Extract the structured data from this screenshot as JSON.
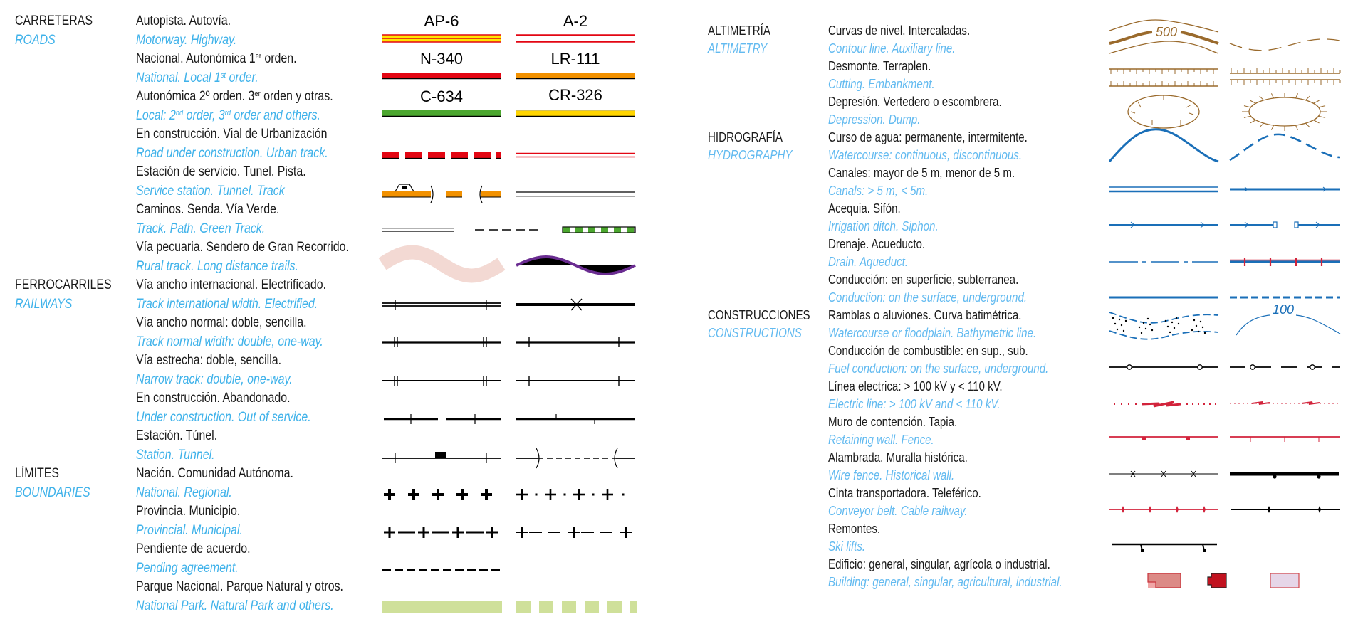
{
  "colors": {
    "text": "#1b1b1b",
    "english_text": "#3fb2ea",
    "road_red": "#e30613",
    "road_yellow": "#ffe600",
    "road_orange": "#f29100",
    "road_green": "#4ca72f",
    "water_blue": "#1a6fb8",
    "contour_brown": "#9a6a2c",
    "park_green": "#cfe09a",
    "trail_purple": "#6a2c91",
    "rural_pink": "#f3d9d3"
  },
  "left": {
    "categories": [
      {
        "row": 0,
        "es": "CARRETERAS",
        "en": "ROADS"
      },
      {
        "row": 7,
        "es": "FERROCARRILES",
        "en": "RAILWAYS"
      },
      {
        "row": 12,
        "es": "LÍMITES",
        "en": "BOUNDARIES"
      }
    ],
    "items": [
      {
        "es": [
          {
            "t": "Autopista. Autovía."
          }
        ],
        "en": [
          {
            "t": "Motorway. Highway."
          }
        ],
        "symbol": "motorway-highway",
        "labels": [
          "AP-6",
          "A-2"
        ]
      },
      {
        "es": [
          {
            "t": "Nacional. Autonómica 1"
          },
          {
            "sup": "er"
          },
          {
            "t": " orden."
          }
        ],
        "en": [
          {
            "t": "National. Local 1"
          },
          {
            "sup": "st"
          },
          {
            "t": " order."
          }
        ],
        "symbol": "national-local",
        "labels": [
          "N-340",
          "LR-111"
        ]
      },
      {
        "es": [
          {
            "t": "Autonómica 2º orden. 3"
          },
          {
            "sup": "er"
          },
          {
            "t": " orden y otras."
          }
        ],
        "en": [
          {
            "t": "Local: 2"
          },
          {
            "sup": "nd"
          },
          {
            "t": " order, 3"
          },
          {
            "sup": "rd"
          },
          {
            "t": " order and others."
          }
        ],
        "symbol": "local-others",
        "labels": [
          "C-634",
          "CR-326"
        ]
      },
      {
        "es": [
          {
            "t": "En construcción. Vial de Urbanización"
          }
        ],
        "en": [
          {
            "t": "Road under construction. Urban track."
          }
        ],
        "symbol": "road-construction-urban"
      },
      {
        "es": [
          {
            "t": "Estación de servicio. Tunel. Pista."
          }
        ],
        "en": [
          {
            "t": "Service station. Tunnel. Track"
          }
        ],
        "symbol": "service-station-tunnel-track"
      },
      {
        "es": [
          {
            "t": "Caminos. Senda. Vía Verde."
          }
        ],
        "en": [
          {
            "t": "Track. Path. Green Track."
          }
        ],
        "symbol": "track-path-green"
      },
      {
        "es": [
          {
            "t": "Vía pecuaria. Sendero de Gran Recorrido."
          }
        ],
        "en": [
          {
            "t": "Rural track. Long distance trails."
          }
        ],
        "symbol": "rural-trail"
      },
      {
        "es": [
          {
            "t": "Vía ancho internacional. Electrificado."
          }
        ],
        "en": [
          {
            "t": "Track international width. Electrified."
          }
        ],
        "symbol": "rail-international"
      },
      {
        "es": [
          {
            "t": "Vía ancho normal: doble, sencilla."
          }
        ],
        "en": [
          {
            "t": "Track normal width: double, one-way."
          }
        ],
        "symbol": "rail-normal"
      },
      {
        "es": [
          {
            "t": "Vía estrecha: doble, sencilla."
          }
        ],
        "en": [
          {
            "t": "Narrow track: double, one-way."
          }
        ],
        "symbol": "rail-narrow"
      },
      {
        "es": [
          {
            "t": "En construcción. Abandonado."
          }
        ],
        "en": [
          {
            "t": "Under construction. Out of service."
          }
        ],
        "symbol": "rail-construction"
      },
      {
        "es": [
          {
            "t": "Estación. Túnel."
          }
        ],
        "en": [
          {
            "t": "Station. Tunnel."
          }
        ],
        "symbol": "rail-station-tunnel"
      },
      {
        "es": [
          {
            "t": "Nación. Comunidad Autónoma."
          }
        ],
        "en": [
          {
            "t": "National. Regional."
          }
        ],
        "symbol": "boundary-national-regional"
      },
      {
        "es": [
          {
            "t": "Provincia. Municipio."
          }
        ],
        "en": [
          {
            "t": "Provincial. Municipal."
          }
        ],
        "symbol": "boundary-provincial-municipal"
      },
      {
        "es": [
          {
            "t": "Pendiente de acuerdo."
          }
        ],
        "en": [
          {
            "t": "Pending agreement."
          }
        ],
        "symbol": "boundary-pending"
      },
      {
        "es": [
          {
            "t": "Parque Nacional. Parque Natural y otros."
          }
        ],
        "en": [
          {
            "t": "National Park. Natural Park and others."
          }
        ],
        "symbol": "park"
      }
    ]
  },
  "right": {
    "categories": [
      {
        "row": 0,
        "es": "ALTIMETRÍA",
        "en": "ALTIMETRY"
      },
      {
        "row": 3,
        "es": "HIDROGRAFÍA",
        "en": "HYDROGRAPHY"
      },
      {
        "row": 8,
        "es": "CONSTRUCCIONES",
        "en": "CONSTRUCTIONS"
      }
    ],
    "items": [
      {
        "es": [
          {
            "t": "Curvas de nivel. Intercaladas."
          }
        ],
        "en": [
          {
            "t": "Contour line. Auxiliary line."
          }
        ],
        "symbol": "contour",
        "labels": [
          "500"
        ]
      },
      {
        "es": [
          {
            "t": "Desmonte. Terraplen."
          }
        ],
        "en": [
          {
            "t": "Cutting. Embankment."
          }
        ],
        "symbol": "cutting-embankment"
      },
      {
        "es": [
          {
            "t": "Depresión. Vertedero o escombrera."
          }
        ],
        "en": [
          {
            "t": "Depression. Dump."
          }
        ],
        "symbol": "depression-dump"
      },
      {
        "es": [
          {
            "t": "Curso de agua: permanente, intermitente."
          }
        ],
        "en": [
          {
            "t": "Watercourse: continuous, discontinuous."
          }
        ],
        "symbol": "watercourse"
      },
      {
        "es": [
          {
            "t": "Canales: mayor de 5 m, menor de 5 m."
          }
        ],
        "en": [
          {
            "t": "Canals: > 5 m, < 5m."
          }
        ],
        "symbol": "canals"
      },
      {
        "es": [
          {
            "t": "Acequia. Sifón."
          }
        ],
        "en": [
          {
            "t": "Irrigation ditch. Siphon."
          }
        ],
        "symbol": "irrigation-siphon"
      },
      {
        "es": [
          {
            "t": "Drenaje. Acueducto."
          }
        ],
        "en": [
          {
            "t": "Drain. Aqueduct."
          }
        ],
        "symbol": "drain-aqueduct"
      },
      {
        "es": [
          {
            "t": "Conducción: en superficie, subterranea."
          }
        ],
        "en": [
          {
            "t": "Conduction: on the surface, underground."
          }
        ],
        "symbol": "conduction"
      },
      {
        "es": [
          {
            "t": "Ramblas o aluviones. Curva batimétrica."
          }
        ],
        "en": [
          {
            "t": "Watercourse or floodplain. Bathymetric line."
          }
        ],
        "symbol": "floodplain-bathymetric",
        "labels": [
          "100"
        ]
      },
      {
        "es": [
          {
            "t": "Conducción de combustible: en sup., sub."
          }
        ],
        "en": [
          {
            "t": "Fuel conduction: on the surface, underground."
          }
        ],
        "symbol": "fuel-conduction"
      },
      {
        "es": [
          {
            "t": "Línea electrica: > 100 kV y < 110 kV."
          }
        ],
        "en": [
          {
            "t": "Electric line: > 100 kV and < 110 kV."
          }
        ],
        "symbol": "electric-line"
      },
      {
        "es": [
          {
            "t": "Muro de contención. Tapia."
          }
        ],
        "en": [
          {
            "t": "Retaining wall. Fence."
          }
        ],
        "symbol": "retaining-wall-fence"
      },
      {
        "es": [
          {
            "t": "Alambrada. Muralla histórica."
          }
        ],
        "en": [
          {
            "t": "Wire fence. Historical wall."
          }
        ],
        "symbol": "wire-fence-wall"
      },
      {
        "es": [
          {
            "t": "Cinta transportadora. Teleférico."
          }
        ],
        "en": [
          {
            "t": "Conveyor belt. Cable railway."
          }
        ],
        "symbol": "conveyor-cable"
      },
      {
        "es": [
          {
            "t": "Remontes."
          }
        ],
        "en": [
          {
            "t": "Ski lifts."
          }
        ],
        "symbol": "ski-lift"
      },
      {
        "es": [
          {
            "t": "Edificio: general, singular, agrícola o industrial."
          }
        ],
        "en": [
          {
            "t": "Building: general, singular, agricultural, industrial."
          }
        ],
        "symbol": "buildings"
      }
    ]
  }
}
